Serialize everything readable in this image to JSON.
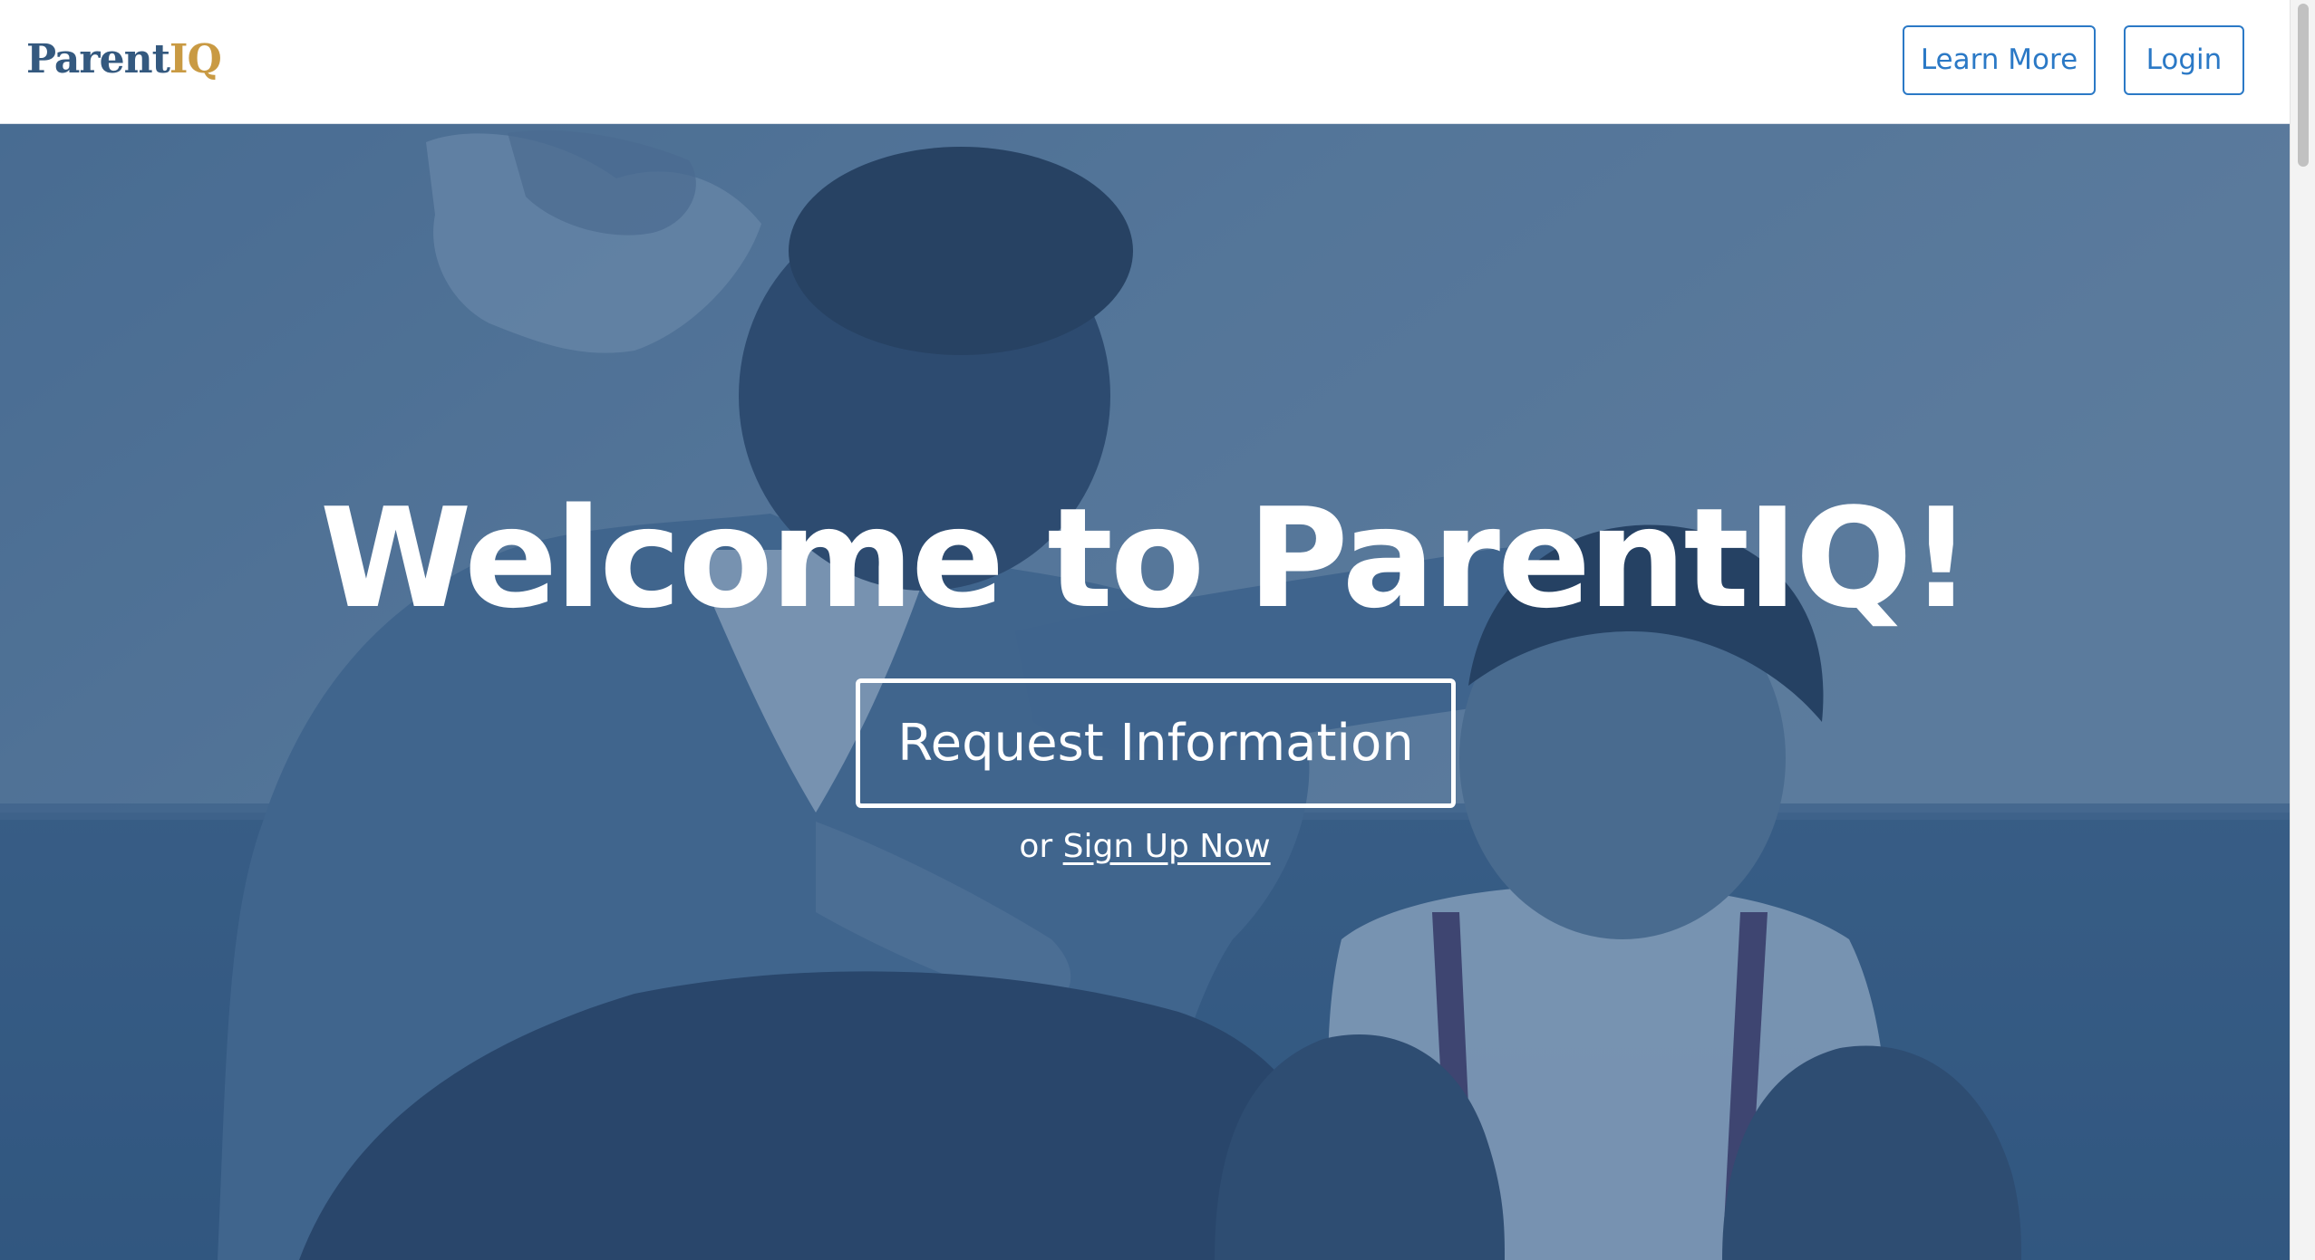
{
  "header": {
    "brand_part1": "Parent",
    "brand_part2": "IQ",
    "learn_more_label": "Learn More",
    "login_label": "Login"
  },
  "hero": {
    "title": "Welcome to ParentIQ!",
    "cta_label": "Request Information",
    "signup_prefix": "or",
    "signup_link_label": "Sign Up Now",
    "background_photo": "man-and-boy-smiling-photo"
  },
  "colors": {
    "brand_blue": "#34597f",
    "brand_gold": "#c99a43",
    "button_blue": "#2b79c6",
    "hero_tint": "#3f6690"
  }
}
